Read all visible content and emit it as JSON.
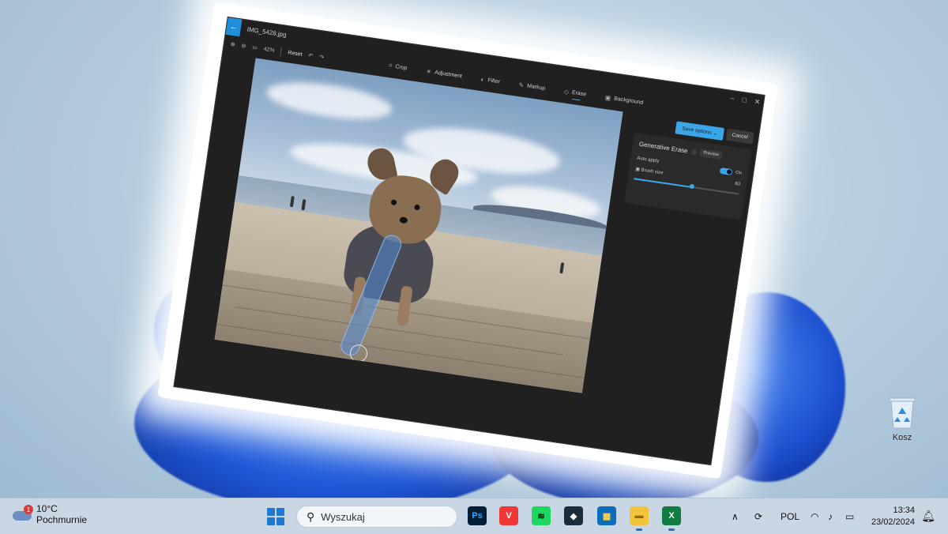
{
  "window": {
    "file_name": "IMG_5428.jpg",
    "back_icon": "arrow-left-icon",
    "controls": [
      "–",
      "□",
      "✕"
    ],
    "left_toolbar": {
      "zoom_percent": "42%",
      "reset_label": "Reset"
    },
    "tools": [
      {
        "label": "Crop",
        "icon": "⌗"
      },
      {
        "label": "Adjustment",
        "icon": "☀"
      },
      {
        "label": "Filter",
        "icon": "◐"
      },
      {
        "label": "Markup",
        "icon": "✎"
      },
      {
        "label": "Erase",
        "icon": "◇"
      },
      {
        "label": "Background",
        "icon": "▣"
      }
    ],
    "active_tool": "Erase",
    "save_label": "Save options",
    "cancel_label": "Cancel",
    "panel": {
      "title": "Generative Erase",
      "preview_label": "Preview",
      "auto_apply_label": "Auto apply",
      "auto_apply_state": "On",
      "brush_size_label": "Brush size",
      "brush_size_value": "60",
      "brush_size_fraction": 0.55
    }
  },
  "desktop": {
    "recycle_bin_label": "Kosz"
  },
  "taskbar": {
    "weather": {
      "temp": "10°C",
      "condition": "Pochmurnie",
      "badge": "1"
    },
    "search_placeholder": "Wyszukaj",
    "apps": [
      {
        "name": "photoshop",
        "glyph": "Ps",
        "color": "#001e36",
        "fg": "#31a8ff"
      },
      {
        "name": "vivaldi",
        "glyph": "V",
        "color": "#ef3939",
        "fg": "#ffffff"
      },
      {
        "name": "spotify",
        "glyph": "≋",
        "color": "#1ed760",
        "fg": "#000000"
      },
      {
        "name": "app-dark",
        "glyph": "◆",
        "color": "#1a2d3d",
        "fg": "#ffffff"
      },
      {
        "name": "store",
        "glyph": "▦",
        "color": "#0f6cbd",
        "fg": "#ffd54a"
      },
      {
        "name": "explorer",
        "glyph": "▬",
        "color": "#f3c33b",
        "fg": "#8a6d12"
      },
      {
        "name": "excel",
        "glyph": "X",
        "color": "#107c41",
        "fg": "#ffffff"
      }
    ],
    "language": "POL",
    "time": "13:34",
    "date": "23/02/2024"
  }
}
